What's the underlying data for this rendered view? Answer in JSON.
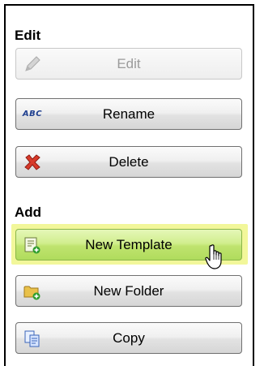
{
  "sections": {
    "edit_header": "Edit",
    "add_header": "Add"
  },
  "buttons": {
    "edit": {
      "label": "Edit",
      "icon": "pencil-icon",
      "disabled": true
    },
    "rename": {
      "label": "Rename",
      "icon": "abc-rename-icon",
      "icon_text": "ABC"
    },
    "delete": {
      "label": "Delete",
      "icon": "red-x-icon"
    },
    "new_template": {
      "label": "New Template",
      "icon": "new-template-icon",
      "highlighted": true
    },
    "new_folder": {
      "label": "New Folder",
      "icon": "new-folder-icon"
    },
    "copy": {
      "label": "Copy",
      "icon": "copy-icon"
    }
  },
  "colors": {
    "highlight_button": "#c6e87a",
    "highlight_ring": "#f2f79a",
    "delete_icon": "#d83a2a",
    "rename_icon_text": "#1f3f8f",
    "folder_icon": "#e9c14a",
    "add_badge": "#2e9d2e"
  }
}
